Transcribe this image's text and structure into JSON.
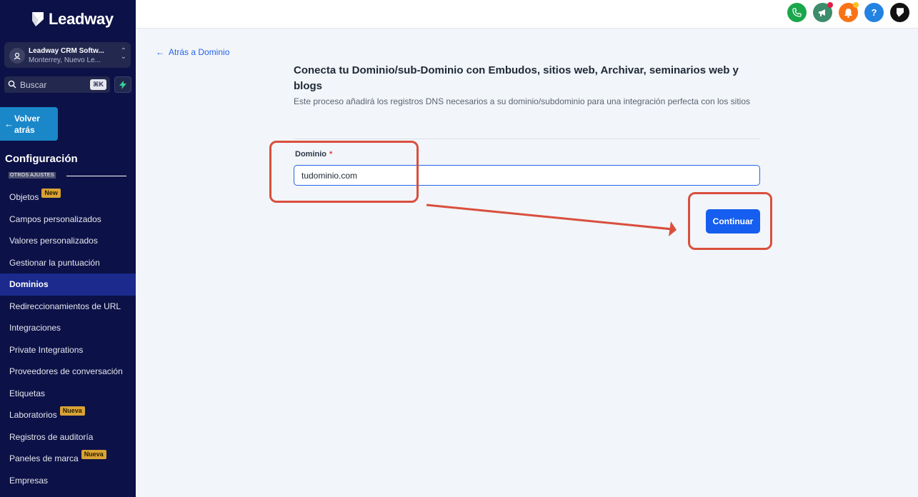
{
  "brand": {
    "name": "Leadway"
  },
  "account": {
    "name": "Leadway CRM Softw...",
    "location": "Monterrey, Nuevo Le..."
  },
  "search": {
    "placeholder": "Buscar",
    "shortcut": "⌘K"
  },
  "back_button": {
    "label": "Volver atrás"
  },
  "sidebar": {
    "title": "Configuración",
    "section_label": "OTROS AJUSTES",
    "items": [
      {
        "label": "Objetos",
        "badge": "New"
      },
      {
        "label": "Campos personalizados",
        "badge": ""
      },
      {
        "label": "Valores personalizados",
        "badge": ""
      },
      {
        "label": "Gestionar la puntuación",
        "badge": ""
      },
      {
        "label": "Dominios",
        "badge": "",
        "active": true
      },
      {
        "label": "Redireccionamientos de URL",
        "badge": ""
      },
      {
        "label": "Integraciones",
        "badge": ""
      },
      {
        "label": "Private Integrations",
        "badge": ""
      },
      {
        "label": "Proveedores de conversación",
        "badge": ""
      },
      {
        "label": "Etiquetas",
        "badge": ""
      },
      {
        "label": "Laboratorios",
        "badge": "Nueva"
      },
      {
        "label": "Registros de auditoría",
        "badge": ""
      },
      {
        "label": "Paneles de marca",
        "badge": "Nueva"
      },
      {
        "label": "Empresas",
        "badge": ""
      }
    ]
  },
  "topbar": {
    "icons": [
      {
        "name": "phone-icon",
        "color": "#1aa64b"
      },
      {
        "name": "megaphone-icon",
        "color": "#3d8c6b"
      },
      {
        "name": "bell-icon",
        "color": "#f97316"
      },
      {
        "name": "help-icon",
        "color": "#2383e2"
      },
      {
        "name": "brand-icon",
        "color": "#111111"
      }
    ]
  },
  "main": {
    "back_link": "Atrás a Dominio",
    "title": "Conecta tu Dominio/sub-Dominio con Embudos, sitios web, Archivar, seminarios web y blogs",
    "description": "Este proceso añadirá los registros DNS necesarios a su dominio/subdominio para una integración perfecta con los sitios",
    "field_label": "Dominio",
    "required_mark": "*",
    "field_value": "tudominio.com",
    "continue_label": "Continuar"
  },
  "colors": {
    "sidebar_bg": "#0c1147",
    "active_item": "#1b2a8c",
    "accent": "#155eef",
    "annotation": "#d94f3d"
  }
}
